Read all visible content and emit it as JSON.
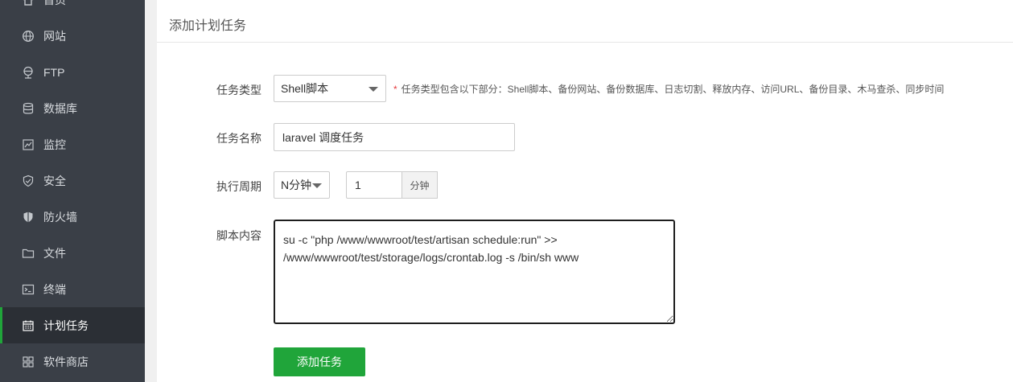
{
  "sidebar": {
    "items": [
      {
        "label": "首页",
        "icon": "home-icon"
      },
      {
        "label": "网站",
        "icon": "globe-icon"
      },
      {
        "label": "FTP",
        "icon": "ftp-icon"
      },
      {
        "label": "数据库",
        "icon": "database-icon"
      },
      {
        "label": "监控",
        "icon": "monitor-icon"
      },
      {
        "label": "安全",
        "icon": "shield-check-icon"
      },
      {
        "label": "防火墙",
        "icon": "firewall-shield-icon"
      },
      {
        "label": "文件",
        "icon": "folder-icon"
      },
      {
        "label": "终端",
        "icon": "terminal-icon"
      },
      {
        "label": "计划任务",
        "icon": "calendar-icon",
        "active": true
      },
      {
        "label": "软件商店",
        "icon": "grid-apps-icon"
      }
    ],
    "active_color": "#20a53a"
  },
  "panel": {
    "title": "添加计划任务"
  },
  "form": {
    "task_type": {
      "label": "任务类型",
      "value": "Shell脚本",
      "hint_star": "*",
      "hint": "任务类型包含以下部分：Shell脚本、备份网站、备份数据库、日志切割、释放内存、访问URL、备份目录、木马查杀、同步时间"
    },
    "task_name": {
      "label": "任务名称",
      "value": "laravel 调度任务"
    },
    "cycle": {
      "label": "执行周期",
      "unit_select": "N分钟",
      "number": "1",
      "addon": "分钟"
    },
    "script": {
      "label": "脚本内容",
      "value": "su -c \"php /www/wwwroot/test/artisan schedule:run\" >> /www/wwwroot/test/storage/logs/crontab.log -s /bin/sh www"
    },
    "submit_label": "添加任务",
    "accent": "#20a53a"
  }
}
